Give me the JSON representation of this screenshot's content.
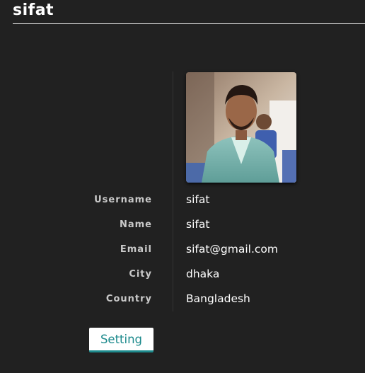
{
  "header": {
    "title": "sifat"
  },
  "profile": {
    "avatar_icon": "profile-photo",
    "fields": [
      {
        "label": "Username",
        "value": "sifat"
      },
      {
        "label": "Name",
        "value": "sifat"
      },
      {
        "label": "Email",
        "value": "sifat@gmail.com"
      },
      {
        "label": "City",
        "value": "dhaka"
      },
      {
        "label": "Country",
        "value": "Bangladesh"
      }
    ]
  },
  "actions": {
    "setting_label": "Setting"
  },
  "colors": {
    "background": "#212121",
    "text": "#ffffff",
    "label": "#c9c9c9",
    "accent": "#1e8b8d"
  }
}
